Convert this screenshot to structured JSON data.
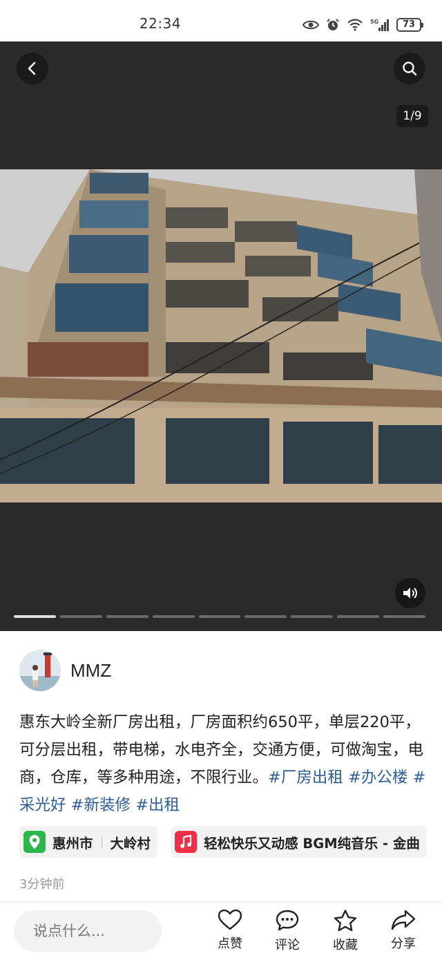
{
  "status_bar": {
    "time": "22:34",
    "network": "5G",
    "battery": "73",
    "icons": [
      "eye-icon",
      "alarm-icon",
      "wifi-icon",
      "signal-icon",
      "battery-icon"
    ]
  },
  "media": {
    "page_counter": "1/9",
    "total_pages": 9,
    "current_page": 1,
    "icons": [
      "back-icon",
      "search-icon",
      "volume-icon"
    ]
  },
  "author": {
    "name": "MMZ"
  },
  "post": {
    "text": "惠东大岭全新厂房出租，厂房面积约650平，单层220平，可分层出租，带电梯，水电齐全，交通方便，可做淘宝，电商，仓库，等多种用途，不限行业。",
    "tags": [
      "#厂房出租",
      "#办公楼",
      "#采光好",
      "#新装修",
      "#出租"
    ],
    "time_ago": "3分钟前"
  },
  "chips": {
    "location_city": "惠州市",
    "location_village": "大岭村",
    "music": "轻松快乐又动感 BGM纯音乐 - 金曲"
  },
  "bottom_bar": {
    "comment_placeholder": "说点什么...",
    "like": "点赞",
    "comment": "评论",
    "collect": "收藏",
    "share": "分享"
  },
  "colors": {
    "tag": "#2f5d98",
    "location_icon_bg": "#2bb74a",
    "music_icon_bg": "#ef2f48",
    "media_bg": "#2a2a2a"
  }
}
